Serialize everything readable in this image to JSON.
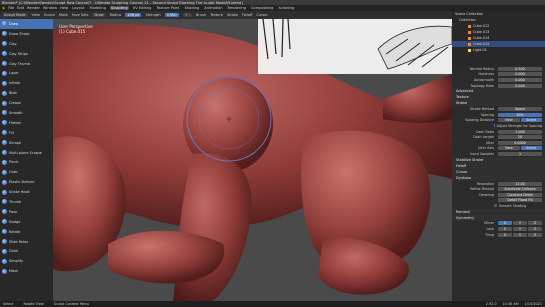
{
  "window": {
    "title": "Blender* [C:\\Blender\\Render\\Sculpt Raw Course\\7 - Ultimate Sculpting Course\\ 21 - Second Sculpt Blocking The Sculpt Model\\9.blend]"
  },
  "menu": {
    "items": [
      "File",
      "Edit",
      "Render",
      "Window",
      "Help"
    ],
    "workspaces": [
      "Layout",
      "Modeling",
      "Sculpting",
      "UV Editing",
      "Texture Paint",
      "Shading",
      "Animation",
      "Rendering",
      "Compositing",
      "Scripting"
    ],
    "active_workspace": "Sculpting"
  },
  "tool_header": {
    "mode": "Sculpt Mode",
    "items": [
      "View",
      "Sculpt",
      "Mask",
      "Face Sets"
    ],
    "brush": "Draw",
    "radius_label": "Radius",
    "radius_value": "106 px",
    "strength_label": "Strength",
    "strength_value": "0.500",
    "direction": "+ -",
    "brush_menu": "Brush",
    "texture_menu": "Texture",
    "stroke_menu": "Stroke",
    "falloff_menu": "Falloff",
    "cursor_menu": "Cursor"
  },
  "viewport": {
    "perspective": "User Perspective",
    "object": "(1) Cube.015"
  },
  "brushes": [
    "Draw",
    "Draw Sharp",
    "Clay",
    "Clay Strips",
    "Clay Thumb",
    "Layer",
    "Inflate",
    "Blob",
    "Crease",
    "Smooth",
    "Flatten",
    "Fill",
    "Scrape",
    "Multi-plane Scrape",
    "Pinch",
    "Grab",
    "Elastic Deform",
    "Snake Hook",
    "Thumb",
    "Pose",
    "Nudge",
    "Rotate",
    "Slide Relax",
    "Cloth",
    "Simplify",
    "Mask"
  ],
  "selected_brush": "Draw",
  "outliner": {
    "rows": [
      "Scene Collection",
      "Collection",
      "Cube.012",
      "Cube.013",
      "Cube.014",
      "Cube.015",
      "Light.01"
    ],
    "highlighted": "Cube.015"
  },
  "properties": {
    "top_rows": [
      {
        "label": "Normal Radius",
        "value": "0.500"
      },
      {
        "label": "Hardness",
        "value": "0.000"
      },
      {
        "label": "Autosmooth",
        "value": "0.000"
      },
      {
        "label": "Topology Rake",
        "value": "0.000"
      }
    ],
    "sections": [
      "Advanced",
      "Texture",
      "Stroke"
    ],
    "stroke_method_label": "Stroke Method",
    "stroke_method_value": "Space",
    "spacing_label": "Spacing",
    "spacing_value": "10%",
    "spacing_distance_label": "Spacing Distance",
    "spacing_distance_options": [
      "View",
      "Scene"
    ],
    "adjust_strength_label": "Adjust Strength for Spacing",
    "dash_ratio_label": "Dash Ratio",
    "dash_ratio_value": "1.000",
    "dash_length_label": "Dash Length",
    "dash_length_value": "20",
    "jitter_label": "Jitter",
    "jitter_value": "0.0000",
    "jitter_axis_label": "Jitter Axis",
    "jitter_axis_options": [
      "View",
      "Scene"
    ],
    "input_samples_label": "Input Samples",
    "input_samples_value": "1",
    "sections2": [
      "Stabilize Stroke",
      "Falloff",
      "Cursor",
      "Dyntopo"
    ],
    "resolution_label": "Resolution",
    "resolution_value": "12.00",
    "refine_method_label": "Refine Method",
    "refine_method_value": "Subdivide Collapse",
    "detailing_label": "Detailing",
    "detailing_value": "Constant Detail",
    "detail_flood_label": "Detail Flood Fill",
    "smooth_shading_label": "Smooth Shading",
    "sections3": [
      "Remesh",
      "Symmetry"
    ],
    "mirror_label": "Mirror",
    "mirror_axes": [
      "X",
      "Y",
      "Z"
    ],
    "lock_label": "Lock",
    "tiling_label": "Tiling"
  },
  "status": {
    "left": "Select",
    "middle": "Rotate View",
    "right": "Sculpt Context Menu",
    "version": "2.92.0",
    "time": "10:36 AM",
    "date": "1/15/2021"
  }
}
